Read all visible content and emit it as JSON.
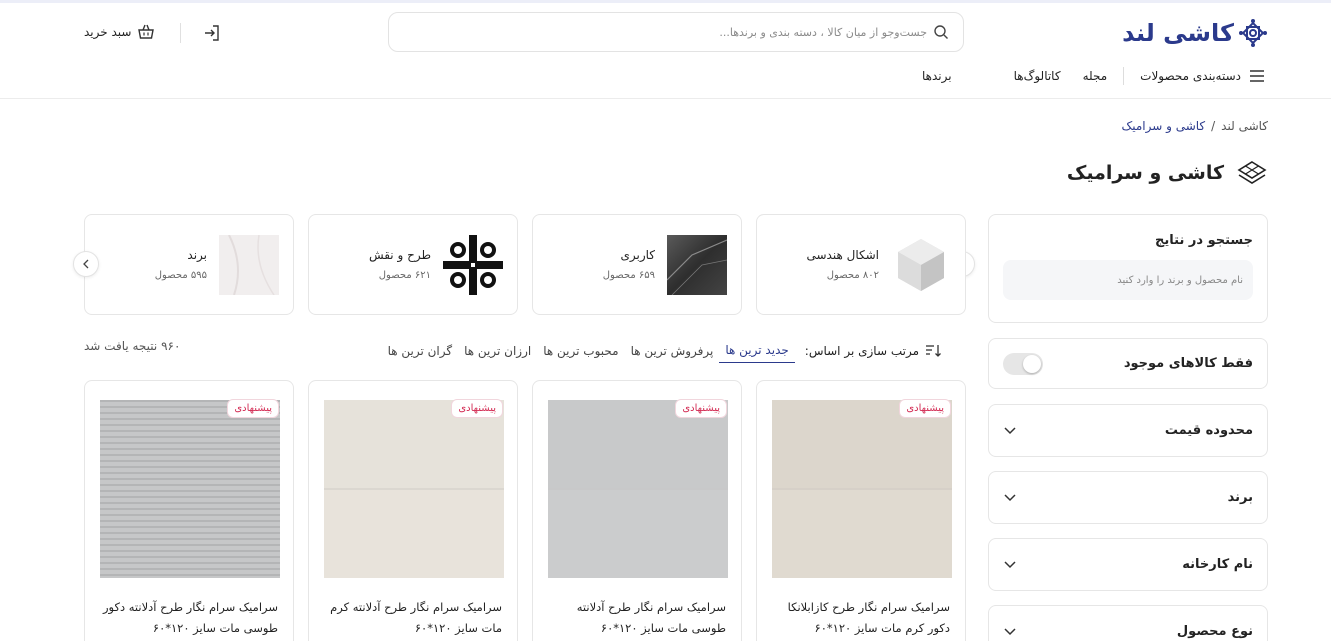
{
  "header": {
    "logo_text": "کاشی لند",
    "search_placeholder": "جست‌وجو از میان کالا ، دسته بندی و برندها...",
    "cart_label": "سبد خرید"
  },
  "nav": {
    "items": [
      {
        "label": "دسته‌بندی محصولات"
      },
      {
        "label": "مجله"
      },
      {
        "label": "کاتالوگ‌ها"
      },
      {
        "label": "برندها"
      }
    ]
  },
  "breadcrumb": {
    "items": [
      {
        "label": "کاشی لند"
      },
      {
        "label": "/"
      },
      {
        "label": "کاشی و سرامیک"
      }
    ]
  },
  "page": {
    "title": "کاشی و سرامیک"
  },
  "sidebar": {
    "search_title": "جستجو در نتایج",
    "search_placeholder": "نام محصول و برند را وارد کنید",
    "available_only": "فقط کالاهای موجود",
    "filters": [
      {
        "label": "محدوده قیمت"
      },
      {
        "label": "برند"
      },
      {
        "label": "نام کارخانه"
      },
      {
        "label": "نوع محصول"
      }
    ]
  },
  "categories": [
    {
      "name": "اشکال هندسی",
      "count": "۸۰۲ محصول"
    },
    {
      "name": "کاربری",
      "count": "۶۵۹ محصول"
    },
    {
      "name": "طرح و نقش",
      "count": "۶۲۱ محصول"
    },
    {
      "name": "برند",
      "count": "۵۹۵ محصول"
    }
  ],
  "sort": {
    "label": "مرتب سازی بر اساس:",
    "options": [
      {
        "label": "جدید ترین ها"
      },
      {
        "label": "پرفروش ترین ها"
      },
      {
        "label": "محبوب ترین ها"
      },
      {
        "label": "ارزان ترین ها"
      },
      {
        "label": "گران ترین ها"
      }
    ],
    "active_index": 0
  },
  "results_count": "۹۶۰ نتیجه یافت شد",
  "products": [
    {
      "badge": "پیشنهادی",
      "name": "سرامیک سرام نگار طرح کازابلانکا دکور کرم مات سایز ۱۲۰*۶۰"
    },
    {
      "badge": "پیشنهادی",
      "name": "سرامیک سرام نگار طرح آدلانته طوسی مات سایز ۱۲۰*۶۰"
    },
    {
      "badge": "پیشنهادی",
      "name": "سرامیک سرام نگار طرح آدلانته کرم مات سایز ۱۲۰*۶۰"
    },
    {
      "badge": "پیشنهادی",
      "name": "سرامیک سرام نگار طرح آدلانته دکور طوسی مات سایز ۱۲۰*۶۰"
    }
  ],
  "colors": {
    "brand": "#2b3a8c",
    "badge": "#d32b53",
    "border": "#e6e6e6"
  }
}
